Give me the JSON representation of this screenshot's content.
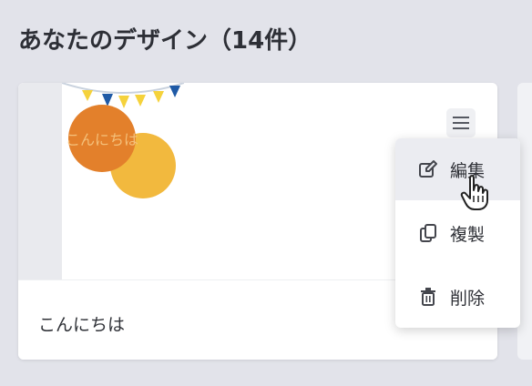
{
  "page": {
    "title": "あなたのデザイン（14件）"
  },
  "card": {
    "thumbnail_text": "こんにちは",
    "name": "こんにちは",
    "menu_icon": "hamburger-menu-icon"
  },
  "context_menu": {
    "items": [
      {
        "label": "編集",
        "icon": "edit-icon",
        "hovered": true
      },
      {
        "label": "複製",
        "icon": "duplicate-icon",
        "hovered": false
      },
      {
        "label": "削除",
        "icon": "trash-icon",
        "hovered": false
      }
    ]
  },
  "colors": {
    "background": "#e2e3ea",
    "card": "#ffffff",
    "orange_circle": "#e3802b",
    "yellow_circle": "#f2b93e",
    "pennant_blue": "#1f5aa6",
    "pennant_yellow": "#f5d23c"
  }
}
